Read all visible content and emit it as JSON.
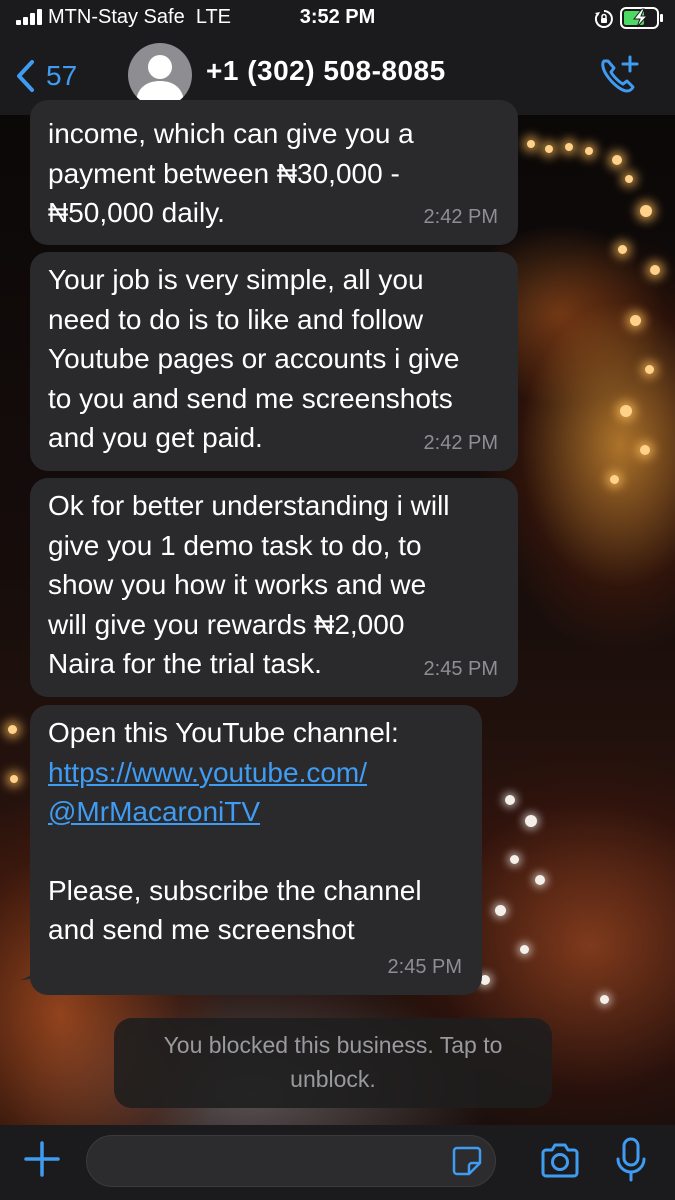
{
  "status_bar": {
    "carrier": "MTN-Stay Safe",
    "network": "LTE",
    "time": "3:52 PM"
  },
  "header": {
    "back_count": "57",
    "contact_name": "+1 (302) 508-8085"
  },
  "messages": [
    {
      "text": "income, which can give you a\npayment between ₦30,000 -\n₦50,000 daily.",
      "time": "2:42 PM"
    },
    {
      "text": "Your job is very simple, all you\nneed to do is to like and follow\nYoutube pages or accounts i give\nto you and send me screenshots\nand you get paid.",
      "time": "2:42 PM"
    },
    {
      "text": "Ok for better understanding i will\ngive you 1 demo task to do, to\nshow you how it works and we\nwill give you rewards ₦2,000\nNaira for the trial task.",
      "time": "2:45 PM"
    },
    {
      "text_before": "Open this YouTube channel:",
      "link_line1": "https://www.youtube.com/",
      "link_line2": "@MrMacaroniTV",
      "text_after": "Please, subscribe the channel\nand send me screenshot",
      "time": "2:45 PM"
    }
  ],
  "notice": {
    "line1": "You blocked this business. Tap to",
    "line2": "unblock."
  },
  "input": {
    "placeholder": ""
  },
  "colors": {
    "accent": "#3f9cf2",
    "bubble": "#2a2a2c",
    "timestamp": "#8e8e93",
    "bar": "#1b1b1d"
  },
  "icons": [
    "signal-icon",
    "rotation-lock-icon",
    "battery-charging-icon",
    "chevron-left-icon",
    "avatar-icon",
    "add-call-icon",
    "plus-icon",
    "sticker-icon",
    "camera-icon",
    "microphone-icon"
  ]
}
